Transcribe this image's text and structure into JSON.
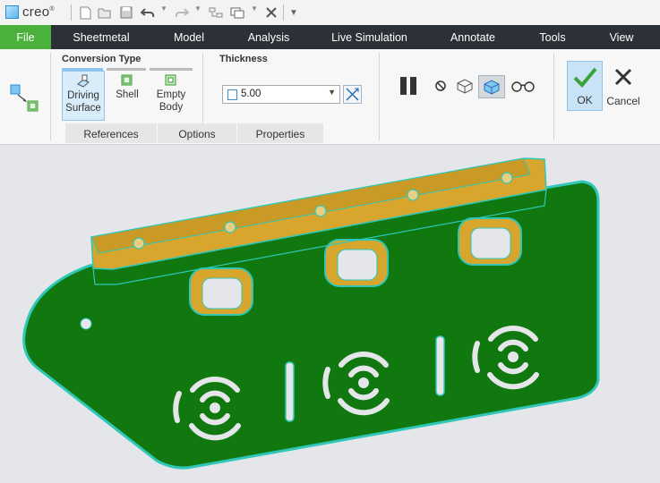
{
  "app": {
    "logo_text": "creo"
  },
  "quick_access": {
    "icons": [
      "new-icon",
      "open-icon",
      "save-icon",
      "undo-icon",
      "redo-icon",
      "regenerate-icon",
      "windows-icon",
      "close-window-icon",
      "customize-icon"
    ]
  },
  "menu_tabs": [
    "File",
    "Sheetmetal",
    "Model",
    "Analysis",
    "Live Simulation",
    "Annotate",
    "Tools",
    "View"
  ],
  "ribbon": {
    "conversion_type_label": "Conversion Type",
    "conversion_options": [
      {
        "line1": "Driving",
        "line2": "Surface",
        "active": true
      },
      {
        "line1": "Shell",
        "line2": "",
        "active": false
      },
      {
        "line1": "Empty",
        "line2": "Body",
        "active": false
      }
    ],
    "thickness_label": "Thickness",
    "thickness_value": "5.00",
    "subtabs": [
      "References",
      "Options",
      "Properties"
    ],
    "ok_label": "OK",
    "cancel_label": "Cancel"
  },
  "colors": {
    "file_tab": "#4ab23a",
    "menu_bar": "#2b3137",
    "part_green": "#10780f",
    "part_edge": "#2fc7b8",
    "flange_yellow": "#d8a62c",
    "canvas_bg": "#e4e6ea"
  }
}
